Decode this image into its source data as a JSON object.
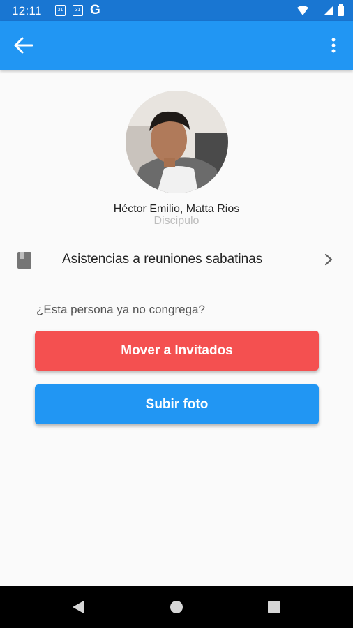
{
  "status_bar": {
    "time": "12:11",
    "calendar_badge_1": "31",
    "calendar_badge_2": "31",
    "g_label": "G"
  },
  "app_bar": {
    "color": "#2196f3",
    "back_icon": "arrow-back-icon",
    "menu_icon": "more-vert-icon"
  },
  "profile": {
    "name": "Héctor Emilio, Matta Rios",
    "role": "Discipulo"
  },
  "attendance": {
    "label": "Asistencias a reuniones sabatinas",
    "icon": "book-icon"
  },
  "question": "¿Esta persona ya no congrega?",
  "buttons": {
    "move_label": "Mover a Invitados",
    "move_color": "#f45050",
    "upload_label": "Subir foto",
    "upload_color": "#2196f3"
  }
}
